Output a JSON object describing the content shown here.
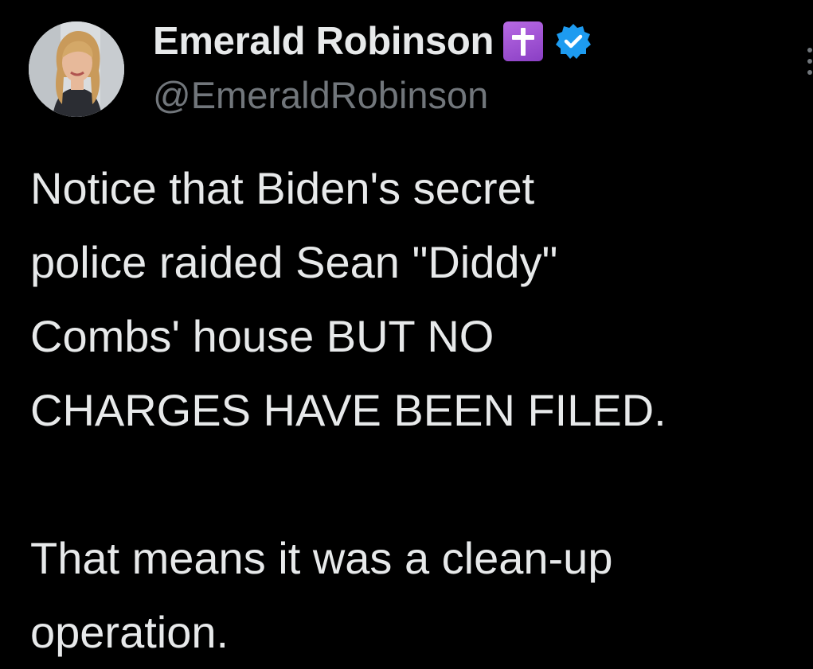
{
  "author": {
    "display_name": "Emerald Robinson",
    "handle": "@EmeraldRobinson",
    "name_emoji": "latin-cross-icon",
    "verified": true,
    "avatar": "avatar-photo"
  },
  "tweet": {
    "paragraph1_lines": [
      "Notice that Biden's secret",
      "police raided Sean \"Diddy\"",
      "Combs' house BUT NO",
      "CHARGES HAVE BEEN FILED."
    ],
    "paragraph2_lines": [
      "That means it was a clean-up",
      "operation."
    ]
  },
  "colors": {
    "background": "#000000",
    "text_primary": "#e7e9ea",
    "text_secondary": "#71767b",
    "verified_blue": "#1d9bf0",
    "emoji_purple": "#9b4fd3"
  },
  "icons": {
    "more": "more-options-icon",
    "verified": "verified-badge-icon"
  }
}
